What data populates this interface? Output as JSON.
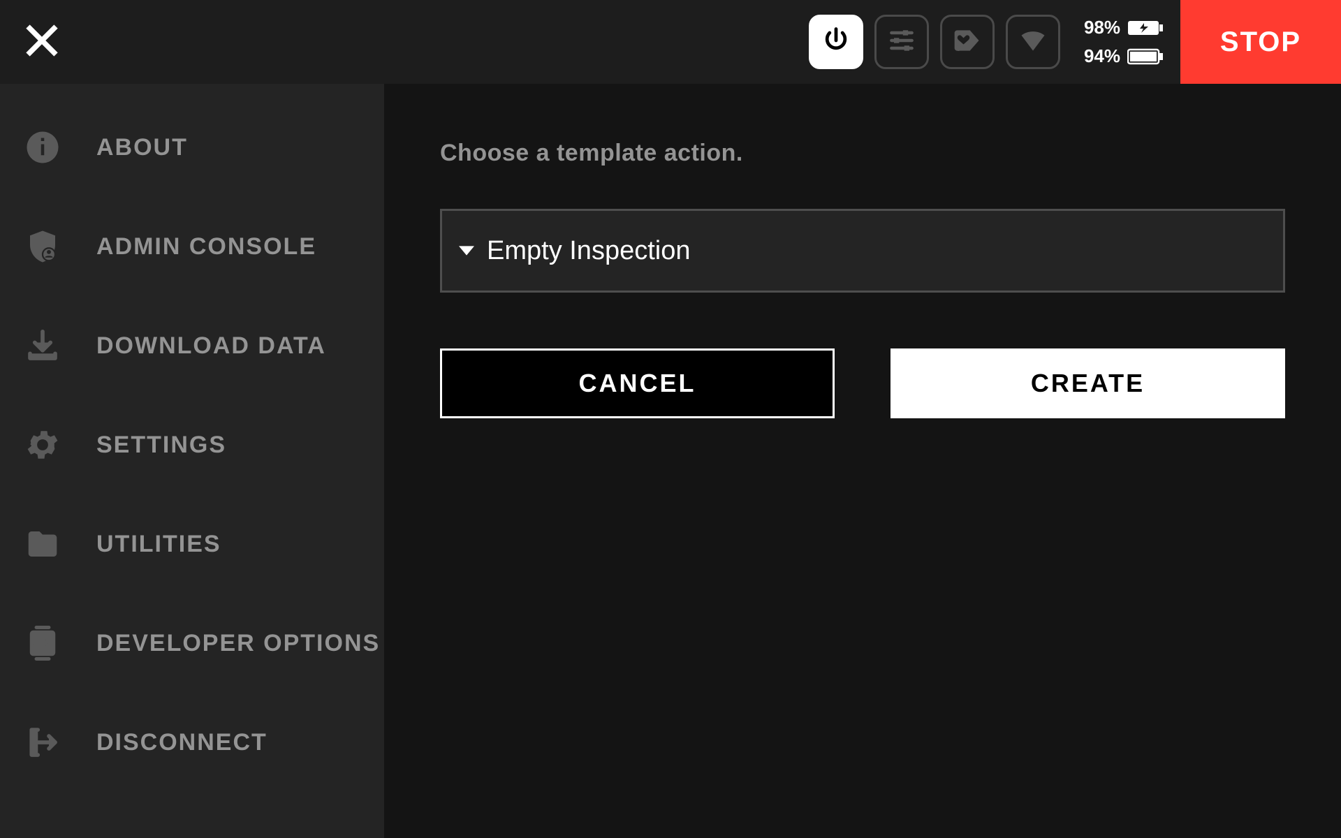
{
  "topbar": {
    "stop_label": "STOP",
    "battery_top": "98%",
    "battery_bottom": "94%"
  },
  "sidebar": {
    "items": [
      {
        "label": "ABOUT"
      },
      {
        "label": "ADMIN CONSOLE"
      },
      {
        "label": "DOWNLOAD DATA"
      },
      {
        "label": "SETTINGS"
      },
      {
        "label": "UTILITIES"
      },
      {
        "label": "DEVELOPER OPTIONS"
      },
      {
        "label": "DISCONNECT"
      }
    ]
  },
  "main": {
    "prompt": "Choose a template action.",
    "dropdown_value": "Empty Inspection",
    "cancel_label": "CANCEL",
    "create_label": "CREATE"
  }
}
